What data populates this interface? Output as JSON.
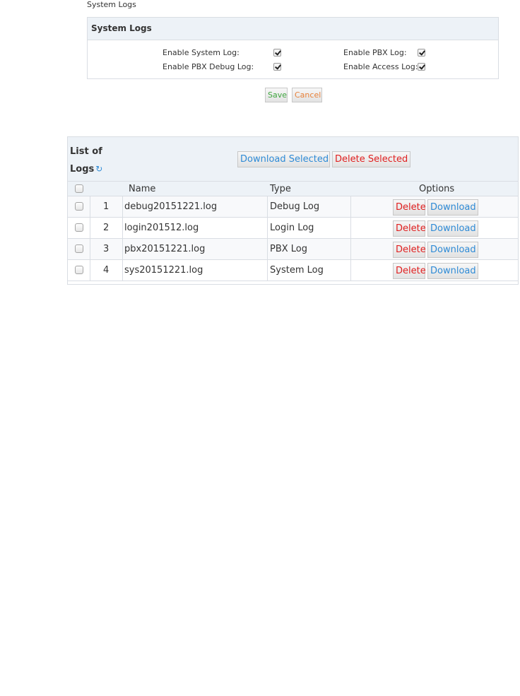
{
  "breadcrumb": "System Logs",
  "settings": {
    "title": "System Logs",
    "options": [
      {
        "label": "Enable System Log:",
        "checked": true
      },
      {
        "label": "Enable PBX Log:",
        "checked": true
      },
      {
        "label": "Enable PBX Debug Log:",
        "checked": true
      },
      {
        "label": "Enable Access Log:",
        "checked": true
      }
    ],
    "save_label": "Save",
    "cancel_label": "Cancel"
  },
  "logs": {
    "title_line1": "List of",
    "title_line2": "Logs",
    "refresh_icon": "refresh-icon",
    "download_selected_label": "Download Selected",
    "delete_selected_label": "Delete Selected",
    "columns": [
      "Name",
      "Type",
      "Options"
    ],
    "rows": [
      {
        "index": "1",
        "name": "debug20151221.log",
        "type": "Debug Log"
      },
      {
        "index": "2",
        "name": "login201512.log",
        "type": "Login Log"
      },
      {
        "index": "3",
        "name": "pbx20151221.log",
        "type": "PBX Log"
      },
      {
        "index": "4",
        "name": "sys20151221.log",
        "type": "System Log"
      }
    ],
    "delete_label": "Delete",
    "download_label": "Download"
  },
  "colors": {
    "header_bg": "#edf2f7",
    "border": "#d9dde3",
    "save": "#3fa63f",
    "cancel": "#e8823b",
    "link_blue": "#2f8bd6",
    "delete_red": "#e02020"
  }
}
